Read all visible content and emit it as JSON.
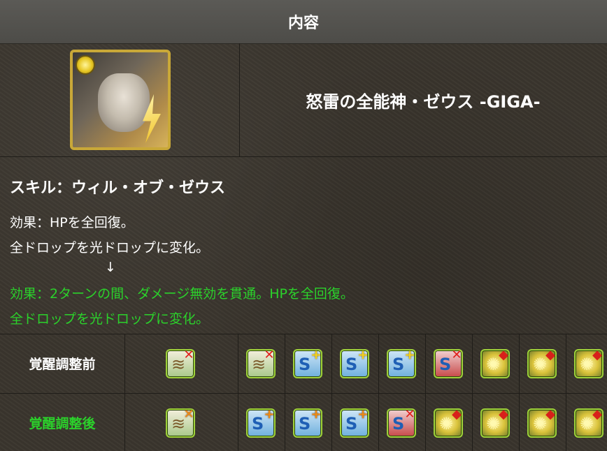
{
  "header": {
    "title": "内容"
  },
  "monster": {
    "name": "怒雷の全能神・ゼウス -GIGA-"
  },
  "skill": {
    "title": "スキル：ウィル・オブ・ゼウス",
    "before_line1": "効果：HPを全回復。",
    "before_line2": "全ドロップを光ドロップに変化。",
    "arrow": "↓",
    "after_line1": "効果：2ターンの間、ダメージ無効を貫通。HPを全回復。",
    "after_line2": "全ドロップを光ドロップに変化。"
  },
  "awakenings": {
    "before_label": "覚醒調整前",
    "after_label": "覚醒調整後",
    "before": [
      "wave-x-icon",
      "wave-x-icon",
      "blue-plus-icon",
      "blue-plus-icon",
      "blue-plus-icon",
      "blue-x-icon",
      "sun-diamond-icon",
      "sun-diamond-icon",
      "sun-diamond-icon"
    ],
    "after": [
      "wave-x-orange-icon",
      "blue-plus-orange-icon",
      "blue-plus-orange-icon",
      "blue-plus-orange-icon",
      "blue-x-icon",
      "sun-diamond-icon",
      "sun-diamond-icon",
      "sun-diamond-icon",
      "sun-diamond-icon"
    ]
  },
  "colors": {
    "green_text": "#2bd12b",
    "header_bg": "#4f4e4a",
    "portrait_border": "#c9a838"
  }
}
